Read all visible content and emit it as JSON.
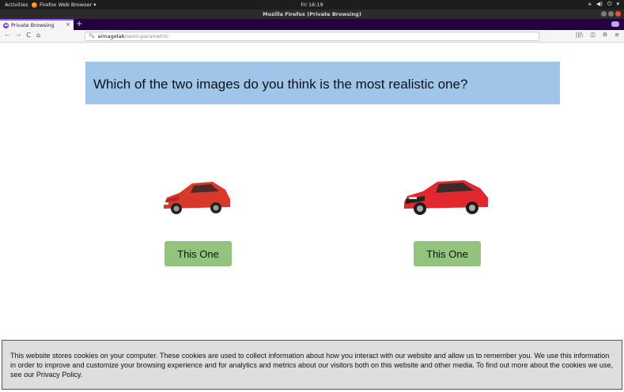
{
  "system_bar": {
    "activities": "Activities",
    "app_name": "Firefox Web Browser ▾",
    "clock": "Fri 16:19",
    "tray": [
      "⚹",
      "◀)",
      "⏻",
      "▾"
    ]
  },
  "window": {
    "title": "Mozilla Firefox (Private Browsing)"
  },
  "tabs": [
    {
      "label": "Private Browsing",
      "close": "×"
    }
  ],
  "new_tab": "+",
  "nav": {
    "back": "←",
    "forward": "→",
    "reload": "C",
    "home": "⌂",
    "url_host": "aimagelab",
    "url_path": "/semi-parametric",
    "search_glyph": "🔍",
    "library": "|||\\",
    "sidebar": "◫",
    "extension": "⚙",
    "menu": "≡"
  },
  "page": {
    "question": "Which of the two images do you think is the most realistic one?",
    "choices": [
      {
        "button_label": "This One",
        "car_color": "#d8392b"
      },
      {
        "button_label": "This One",
        "car_color": "#e0282e"
      }
    ]
  },
  "cookie_banner": {
    "text": "This website stores cookies on your computer. These cookies are used to collect information about how you interact with our website and allow us to remember you. We use this information in order to improve and customize your browsing experience and for analytics and metrics about our visitors both on this website and other media. To find out more about the cookies we use, see our Privacy Policy."
  },
  "colors": {
    "banner": "#9fc5e8",
    "button": "#93c47d",
    "private_tab_strip": "#25003e"
  }
}
